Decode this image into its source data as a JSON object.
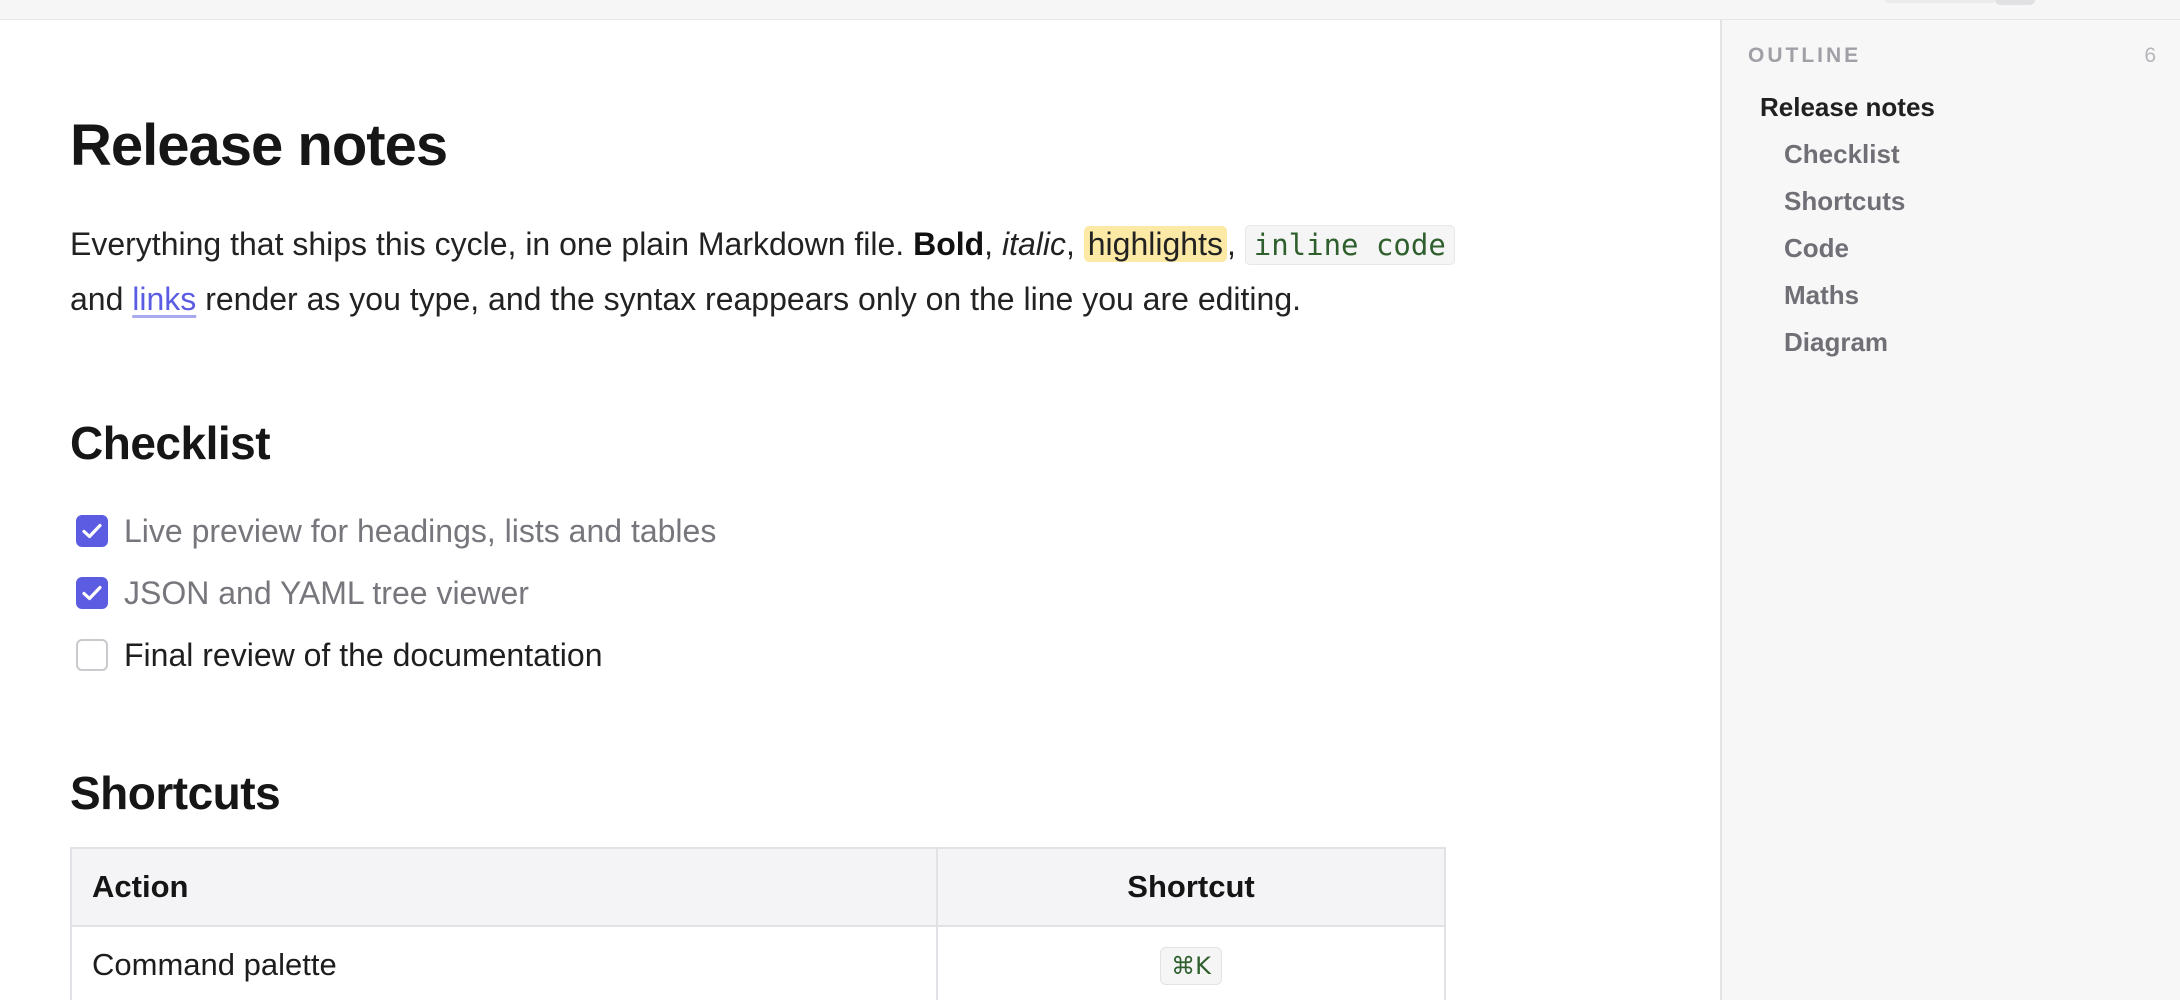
{
  "document": {
    "title": "Release notes",
    "intro": {
      "t1": "Everything that ships this cycle, in one plain Markdown file. ",
      "bold": "Bold",
      "t2": ", ",
      "italic": "italic",
      "t3": ", ",
      "highlight": "highlights",
      "t4": ", ",
      "code": "inline code",
      "t5": " and ",
      "link": "links",
      "t6": " render as you type, and the syntax reappears only on the line you are editing."
    },
    "checklist": {
      "heading": "Checklist",
      "items": [
        {
          "text": "Live preview for headings, lists and tables",
          "checked": true
        },
        {
          "text": "JSON and YAML tree viewer",
          "checked": true
        },
        {
          "text": "Final review of the documentation",
          "checked": false
        }
      ]
    },
    "shortcuts": {
      "heading": "Shortcuts",
      "columns": [
        "Action",
        "Shortcut"
      ],
      "rows": [
        {
          "action": "Command palette",
          "shortcut": "⌘K"
        }
      ]
    }
  },
  "outline": {
    "label": "OUTLINE",
    "count": "6",
    "items": [
      {
        "label": "Release notes",
        "level": 1
      },
      {
        "label": "Checklist",
        "level": 2
      },
      {
        "label": "Shortcuts",
        "level": 2
      },
      {
        "label": "Code",
        "level": 2
      },
      {
        "label": "Maths",
        "level": 2
      },
      {
        "label": "Diagram",
        "level": 2
      }
    ]
  },
  "colors": {
    "accent": "#5b5ce2",
    "highlight": "#fde9a6",
    "code_text": "#2f5f2d"
  }
}
